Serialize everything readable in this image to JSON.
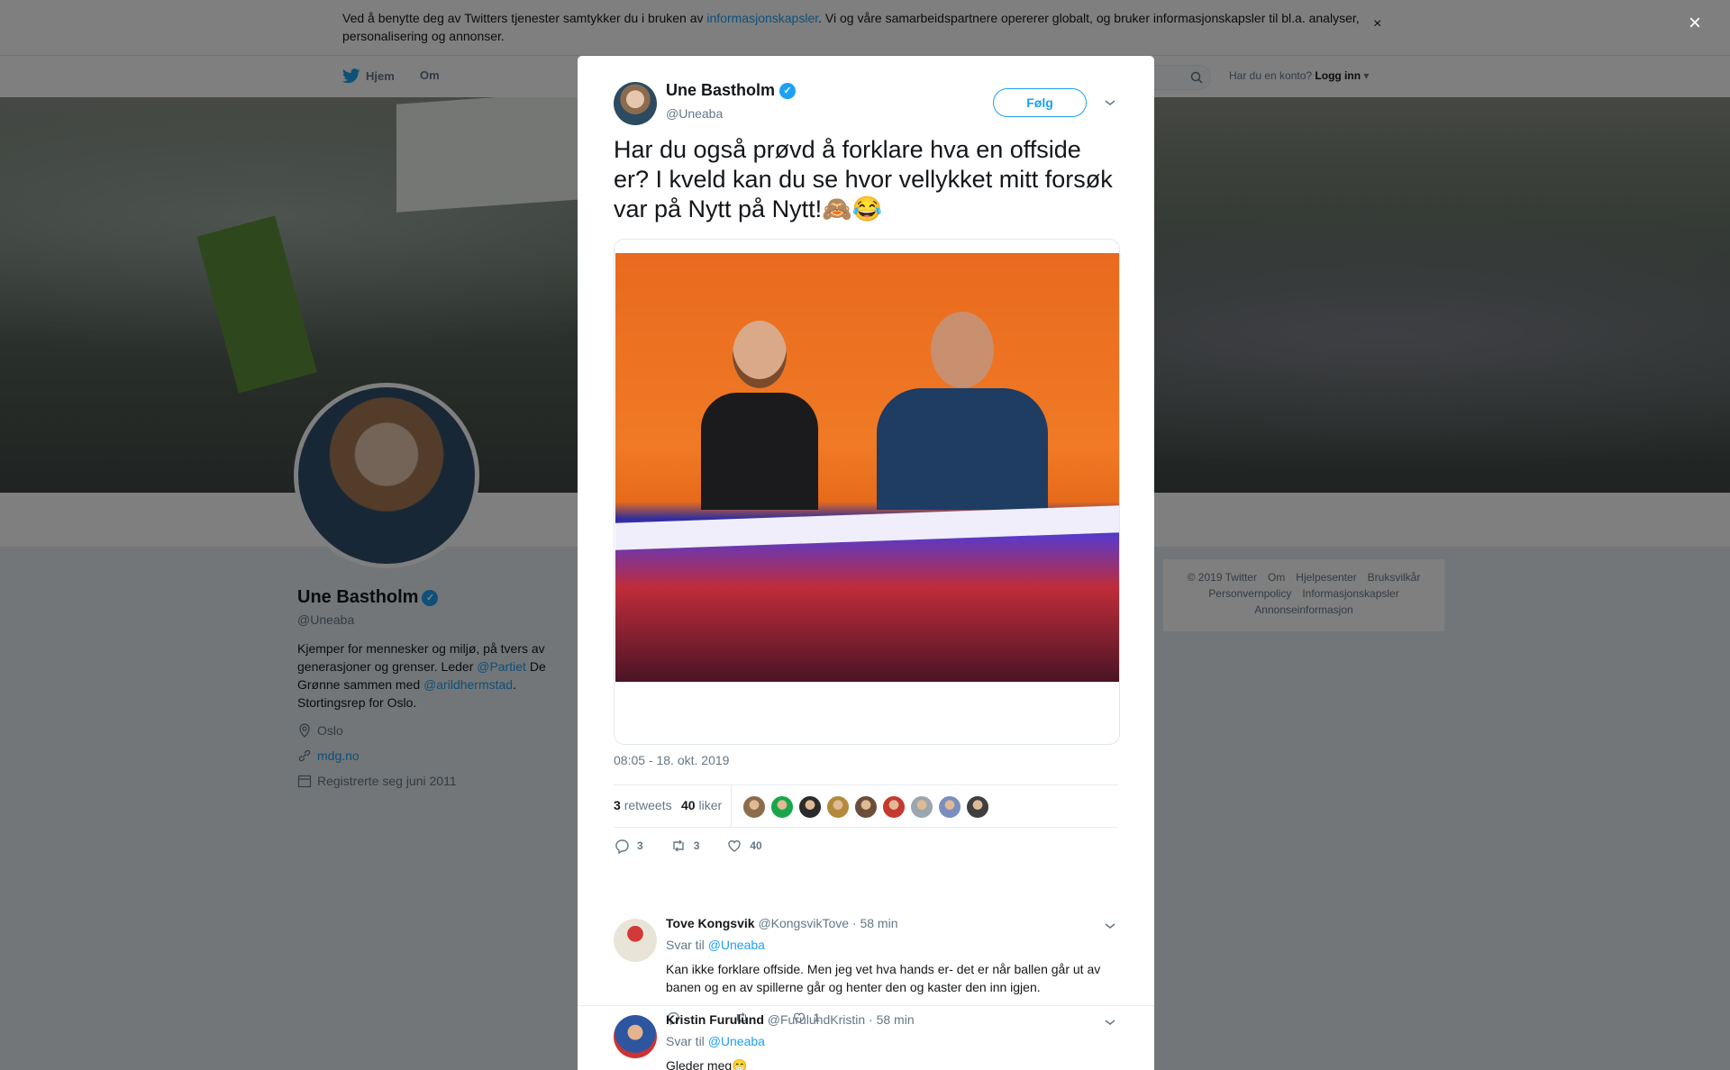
{
  "cookie": {
    "text_before": "Ved å benytte deg av Twitters tjenester samtykker du i bruken av ",
    "link": "informasjonskapsler",
    "text_after": ". Vi og våre samarbeidspartnere opererer globalt, og bruker informasjonskapsler til bl.a. analyser, personalisering og annonser.",
    "close": "×"
  },
  "nav": {
    "home": "Hjem",
    "about": "Om",
    "account_question": "Har du en konto?",
    "login": "Logg inn"
  },
  "profile": {
    "name": "Une Bastholm",
    "handle": "@Uneaba",
    "bio_1": "Kjemper for mennesker og miljø, på tvers av generasjoner og grenser. Leder ",
    "bio_link_1": "@Partiet",
    "bio_2": " De Grønne sammen med ",
    "bio_link_2": "@arildhermstad",
    "bio_3": ". Stortingsrep for Oslo.",
    "location": "Oslo",
    "website": "mdg.no",
    "joined": "Registrerte seg juni 2011"
  },
  "footer": {
    "copyright": "© 2019 Twitter",
    "about": "Om",
    "help": "Hjelpesenter",
    "terms": "Bruksvilkår",
    "privacy": "Personvernpolicy",
    "cookies": "Informasjonskapsler",
    "ads": "Annonseinformasjon"
  },
  "overlay_close": "×",
  "tweet": {
    "author_name": "Une Bastholm",
    "author_handle": "@Uneaba",
    "follow_label": "Følg",
    "text": "Har du også prøvd å forklare hva en offside er? I kveld kan du se hvor vellykket mitt forsøk var på Nytt på Nytt!🙈😂",
    "timestamp": "08:05 - 18. okt. 2019",
    "retweets_count": "3",
    "retweets_label": "retweets",
    "likes_count": "40",
    "likes_label": "liker",
    "reply_count": "3",
    "retweet_action_count": "3",
    "like_action_count": "40"
  },
  "likers": [
    "#8a6d4a",
    "#19a64a",
    "#2b2b2b",
    "#b38a3a",
    "#6b4e3a",
    "#c43a2e",
    "#9aa6b0",
    "#7a8fbf",
    "#3f3f3f"
  ],
  "replies": [
    {
      "name": "Tove Kongsvik",
      "handle": "@KongsvikTove",
      "time": "· 58 min",
      "reply_to_label": "Svar til",
      "reply_to": "@Uneaba",
      "text": "Kan ikke forklare offside. Men jeg vet hva hands er- det er når ballen går ut av banen og en av spillerne går og henter den og kaster den inn igjen.",
      "reply_count": "",
      "retweet_count": "",
      "like_count": "1"
    },
    {
      "name": "Kristin Furulund",
      "handle": "@FurulundKristin",
      "time": "· 58 min",
      "reply_to_label": "Svar til",
      "reply_to": "@Uneaba",
      "text": "Gleder meg😁"
    }
  ]
}
